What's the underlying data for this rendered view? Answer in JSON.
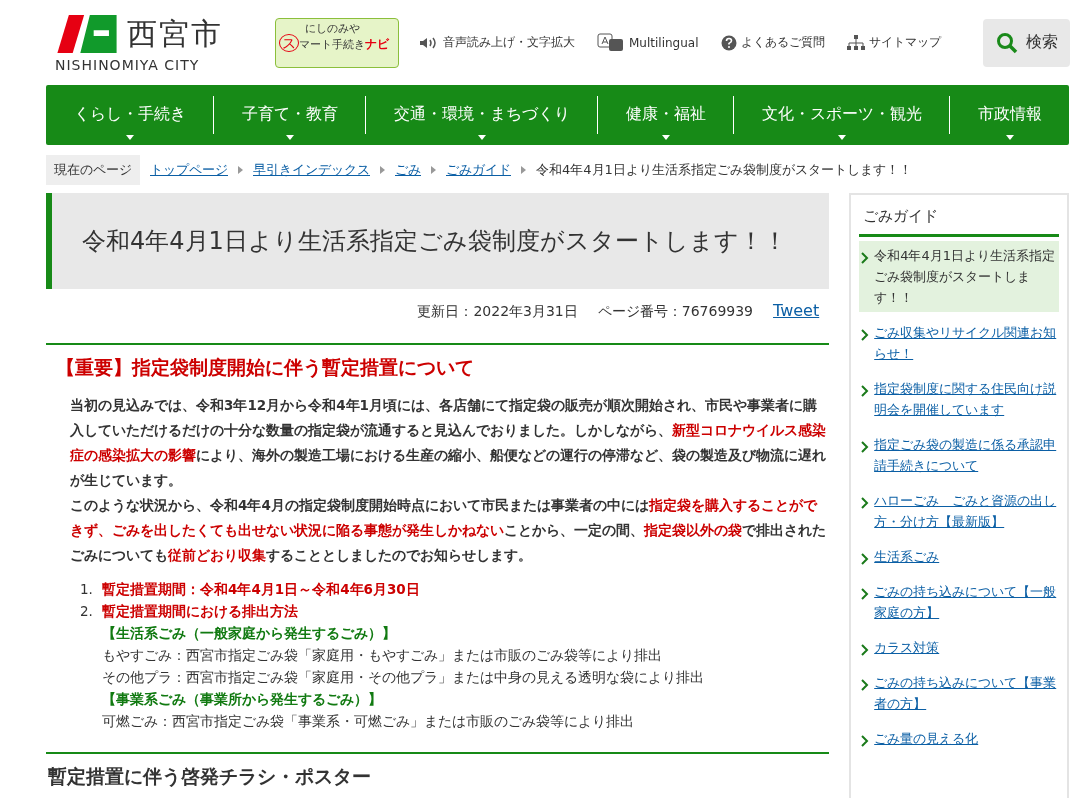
{
  "header": {
    "logo_name": "西宮市",
    "logo_sub": "NISHINOMIYA CITY",
    "banner_line1": "にしのみや",
    "banner_initial": "ス",
    "banner_line2": "マート手続き",
    "banner_accent": "ナビ",
    "utility_links": [
      {
        "kind": "speaker",
        "label": "音声読み上げ・文字拡大"
      },
      {
        "kind": "language",
        "label": "Multilingual"
      },
      {
        "kind": "question",
        "label": "よくあるご質問"
      },
      {
        "kind": "sitemap",
        "label": "サイトマップ"
      }
    ],
    "search_button": "検索"
  },
  "nav": [
    "くらし・手続き",
    "子育て・教育",
    "交通・環境・まちづくり",
    "健康・福祉",
    "文化・スポーツ・観光",
    "市政情報"
  ],
  "breadcrumb": {
    "label": "現在のページ",
    "links": [
      "トップページ",
      "早引きインデックス",
      "ごみ",
      "ごみガイド"
    ],
    "current": "令和4年4月1日より生活系指定ごみ袋制度がスタートします！！"
  },
  "page_title": "令和4年4月1日より生活系指定ごみ袋制度がスタートします！！",
  "meta": {
    "updated": "更新日：2022年3月31日",
    "page_number": "ページ番号：76769939",
    "tweet": "Tweet"
  },
  "section": {
    "heading": "【重要】指定袋制度開始に伴う暫定措置について",
    "paragraphs": [
      [
        {
          "text": "当初の見込みでは、令和3年12月から令和4年1月頃には、各店舗にて指定袋の販売が順次開始され、市民や事業者に購入していただけるだけの十分な数量の指定袋が流通すると見込んでおりました。しかしながら、",
          "emphasis": false
        },
        {
          "text": "新型コロナウイルス感染症の感染拡大の影響",
          "emphasis": true
        },
        {
          "text": "により、海外の製造工場における生産の縮小、船便などの運行の停滞など、袋の製造及び物流に遅れが生じています。",
          "emphasis": false
        }
      ],
      [
        {
          "text": "このような状況から、令和4年4月の指定袋制度開始時点において市民または事業者の中には",
          "emphasis": false
        },
        {
          "text": "指定袋を購入することができず、ごみを出したくても出せない状況に陥る事態が発生しかねない",
          "emphasis": true
        },
        {
          "text": "ことから、一定の間、",
          "emphasis": false
        },
        {
          "text": "指定袋以外の袋",
          "emphasis": true
        },
        {
          "text": "で排出されたごみについても",
          "emphasis": false
        },
        {
          "text": "従前どおり収集",
          "emphasis": true
        },
        {
          "text": "することとしましたのでお知らせします。",
          "emphasis": false
        }
      ]
    ],
    "list": [
      {
        "number": "1.",
        "title": "暫定措置期間：令和4年4月1日～令和4年6月30日"
      },
      {
        "number": "2.",
        "title": "暫定措置期間における排出方法",
        "lines": [
          {
            "kind": "category",
            "text": "【生活系ごみ（一般家庭から発生するごみ）】"
          },
          {
            "kind": "plain",
            "text": "もやすごみ：西宮市指定ごみ袋「家庭用・もやすごみ」または市販のごみ袋等により排出"
          },
          {
            "kind": "plain",
            "text": "その他プラ：西宮市指定ごみ袋「家庭用・その他プラ」または中身の見える透明な袋により排出"
          },
          {
            "kind": "category",
            "text": "【事業系ごみ（事業所から発生するごみ）】"
          },
          {
            "kind": "plain",
            "text": "可燃ごみ：西宮市指定ごみ袋「事業系・可燃ごみ」または市販のごみ袋等により排出"
          }
        ]
      }
    ]
  },
  "next_heading": "暫定措置に伴う啓発チラシ・ポスター",
  "sidebar": {
    "title": "ごみガイド",
    "items": [
      {
        "label": "令和4年4月1日より生活系指定ごみ袋制度がスタートします！！",
        "selected": true
      },
      {
        "label": "ごみ収集やリサイクル関連お知らせ！",
        "selected": false
      },
      {
        "label": "指定袋制度に関する住民向け説明会を開催しています",
        "selected": false
      },
      {
        "label": "指定ごみ袋の製造に係る承認申請手続きについて",
        "selected": false
      },
      {
        "label": "ハローごみ　ごみと資源の出し方・分け方【最新版】",
        "selected": false
      },
      {
        "label": "生活系ごみ",
        "selected": false
      },
      {
        "label": "ごみの持ち込みについて【一般家庭の方】",
        "selected": false
      },
      {
        "label": "カラス対策",
        "selected": false
      },
      {
        "label": "ごみの持ち込みについて【事業者の方】",
        "selected": false
      },
      {
        "label": "ごみ量の見える化",
        "selected": false
      }
    ]
  }
}
